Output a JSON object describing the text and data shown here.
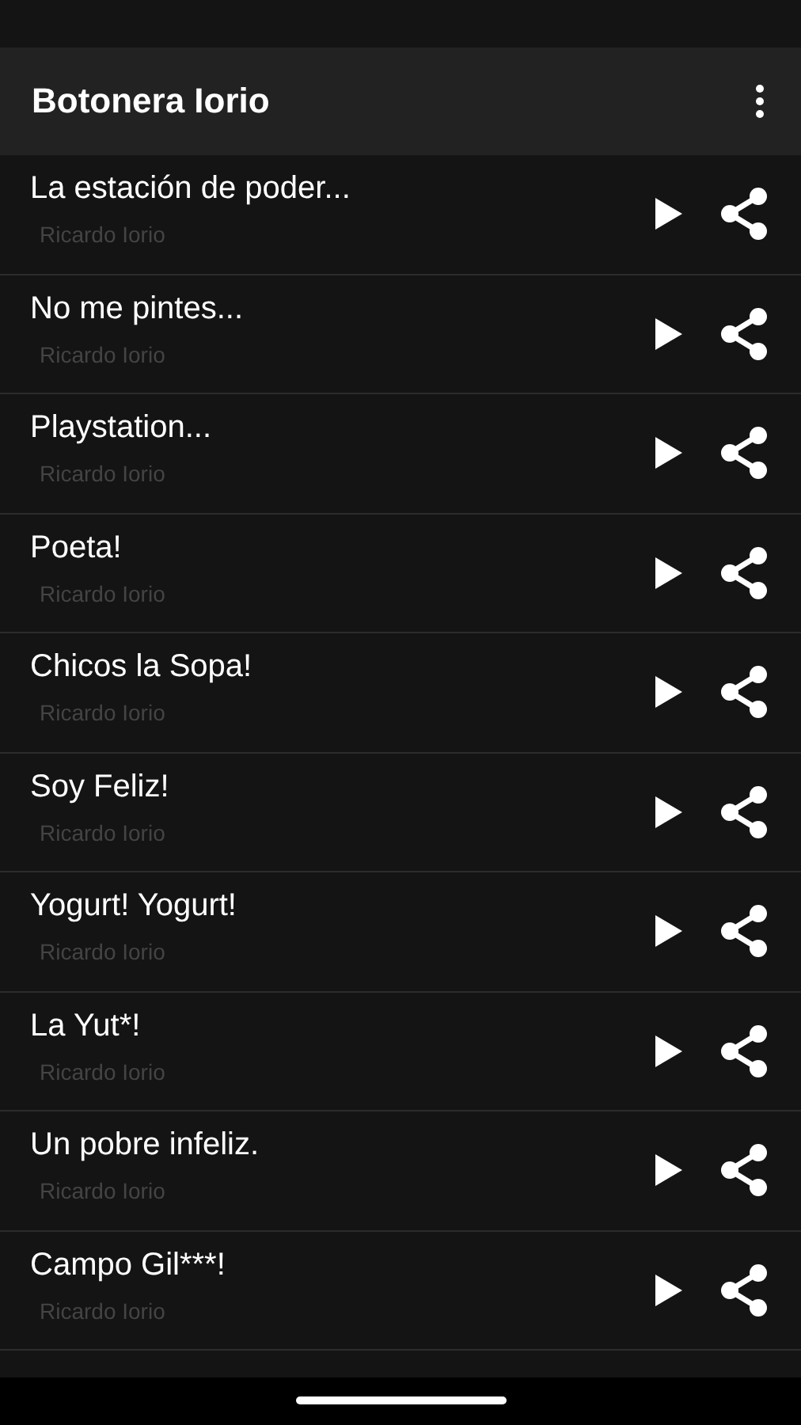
{
  "app_bar": {
    "title": "Botonera Iorio"
  },
  "sounds": [
    {
      "title": "La estación de poder...",
      "artist": "Ricardo Iorio"
    },
    {
      "title": "No me pintes...",
      "artist": "Ricardo Iorio"
    },
    {
      "title": "Playstation...",
      "artist": "Ricardo Iorio"
    },
    {
      "title": "Poeta!",
      "artist": "Ricardo Iorio"
    },
    {
      "title": "Chicos la Sopa!",
      "artist": "Ricardo Iorio"
    },
    {
      "title": "Soy Feliz!",
      "artist": "Ricardo Iorio"
    },
    {
      "title": "Yogurt! Yogurt!",
      "artist": "Ricardo Iorio"
    },
    {
      "title": "La Yut*!",
      "artist": "Ricardo Iorio"
    },
    {
      "title": "Un pobre infeliz.",
      "artist": "Ricardo Iorio"
    },
    {
      "title": "Campo Gil***!",
      "artist": "Ricardo Iorio"
    }
  ]
}
